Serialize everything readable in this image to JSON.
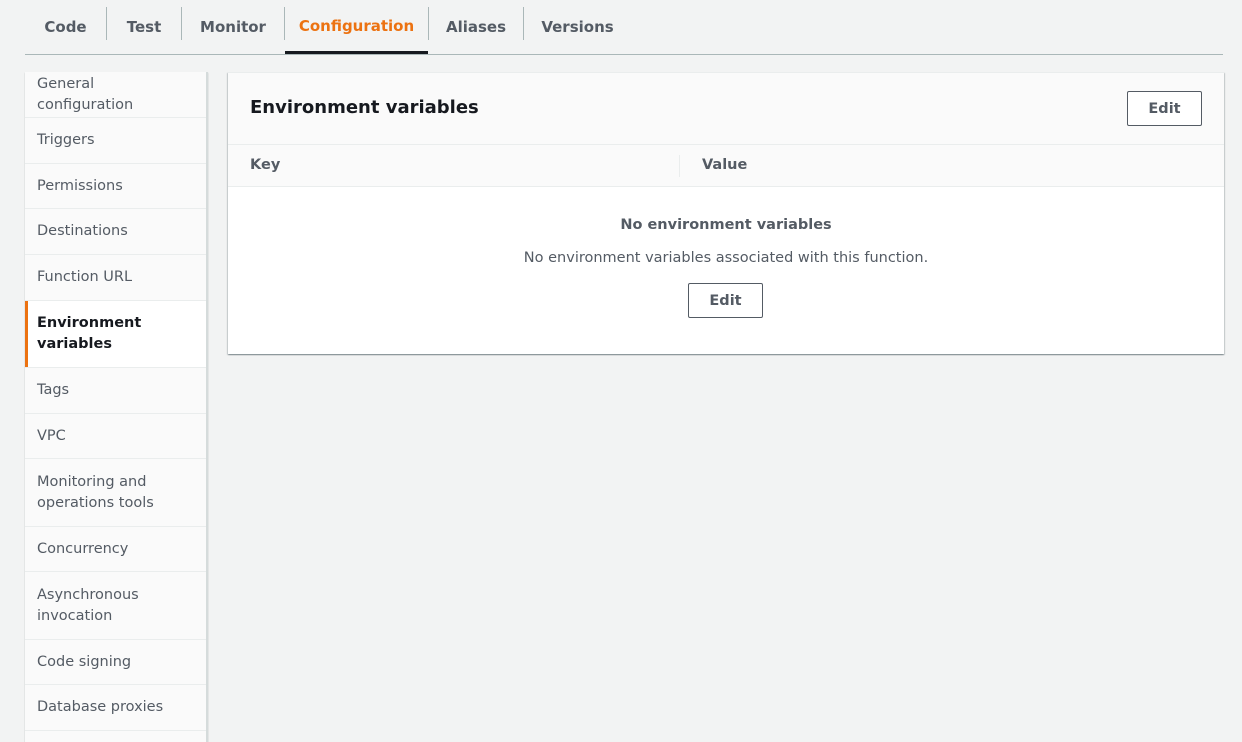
{
  "tabs": [
    {
      "label": "Code"
    },
    {
      "label": "Test"
    },
    {
      "label": "Monitor"
    },
    {
      "label": "Configuration",
      "active": true
    },
    {
      "label": "Aliases"
    },
    {
      "label": "Versions"
    }
  ],
  "sidebar": {
    "items": [
      {
        "label": "General configuration"
      },
      {
        "label": "Triggers"
      },
      {
        "label": "Permissions"
      },
      {
        "label": "Destinations"
      },
      {
        "label": "Function URL"
      },
      {
        "label": "Environment variables",
        "active": true
      },
      {
        "label": "Tags"
      },
      {
        "label": "VPC"
      },
      {
        "label": "Monitoring and operations tools"
      },
      {
        "label": "Concurrency"
      },
      {
        "label": "Asynchronous invocation"
      },
      {
        "label": "Code signing"
      },
      {
        "label": "Database proxies"
      }
    ]
  },
  "panel": {
    "title": "Environment variables",
    "edit_label": "Edit",
    "columns": {
      "key": "Key",
      "value": "Value"
    },
    "empty": {
      "title": "No environment variables",
      "description": "No environment variables associated with this function.",
      "edit_label": "Edit"
    }
  },
  "colors": {
    "accent": "#ec7211",
    "text": "#16191f",
    "muted": "#545b64",
    "background": "#f2f3f3"
  }
}
